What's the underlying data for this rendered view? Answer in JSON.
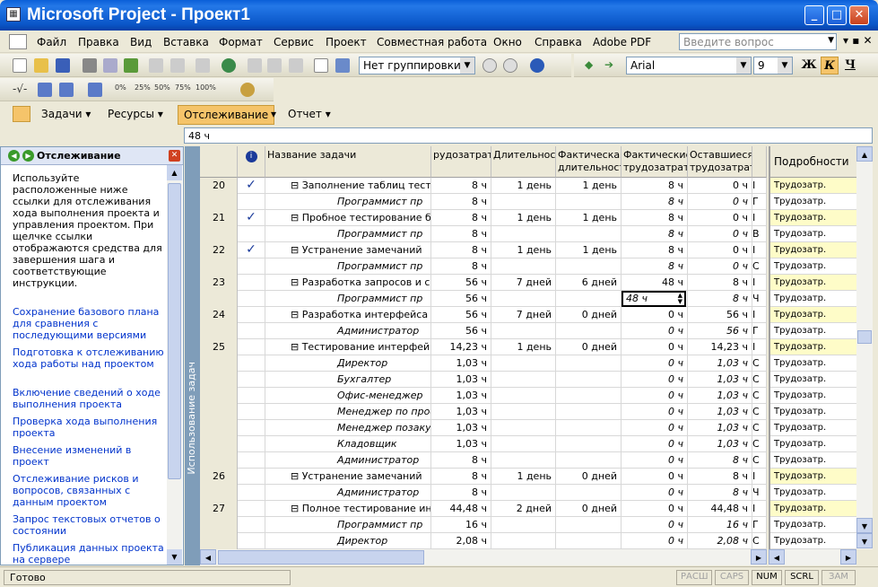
{
  "window": {
    "title": "Microsoft Project - Проект1",
    "minimize": "_",
    "restore": "□",
    "close": "✕"
  },
  "menu": {
    "items": [
      "Файл",
      "Правка",
      "Вид",
      "Вставка",
      "Формат",
      "Сервис",
      "Проект",
      "Совместная работа",
      "Окно",
      "Справка",
      "Adobe PDF"
    ],
    "ask_placeholder": "Введите вопрос"
  },
  "toolbar": {
    "group_combo": "Нет группировки",
    "font_combo": "Arial",
    "size_combo": "9",
    "bold": "Ж",
    "italic": "К",
    "underline": "Ч",
    "percent_buttons": [
      "0%",
      "25%",
      "50%",
      "75%",
      "100%"
    ]
  },
  "guide": {
    "tasks": "Задачи",
    "resources": "Ресурсы",
    "tracking": "Отслеживание",
    "report": "Отчет"
  },
  "entry": {
    "value": "48 ч"
  },
  "sidepane": {
    "title": "Отслеживание",
    "intro": "Используйте расположенные ниже ссылки для отслеживания хода выполнения проекта и управления проектом. При щелчке ссылки отображаются средства для завершения шага и соответствующие инструкции.",
    "links": [
      "Сохранение базового плана для сравнения с последующими версиями",
      "Подготовка к отслеживанию хода работы над проектом",
      "Включение сведений о ходе выполнения проекта",
      "Проверка хода выполнения проекта",
      "Внесение изменений в проект",
      "Отслеживание рисков и вопросов, связанных с данным проектом",
      "Запрос текстовых отчетов о состоянии",
      "Публикация данных проекта на сервере"
    ]
  },
  "view_label": "Использование задач",
  "grid": {
    "headers": {
      "info": "i",
      "name": "Название задачи",
      "work": "рудозатрат",
      "duration": "Длительност",
      "actual_duration": "Фактическая длительност",
      "actual_work": "Фактические трудозатрать",
      "remaining_work": "Оставшиеся трудозатрать"
    },
    "rows": [
      {
        "num": "20",
        "check": "✓",
        "name": "⊟ Заполнение таблиц тест",
        "work": "8 ч",
        "dur": "1 день",
        "adur": "1 день",
        "awork": "8 ч",
        "rwork": "0 ч",
        "x": "I",
        "sub": false
      },
      {
        "num": "",
        "check": "",
        "name": "Программист пр",
        "work": "8 ч",
        "dur": "",
        "adur": "",
        "awork": "8 ч",
        "rwork": "0 ч",
        "x": "Г",
        "sub": true
      },
      {
        "num": "21",
        "check": "✓",
        "name": "⊟ Пробное тестирование б",
        "work": "8 ч",
        "dur": "1 день",
        "adur": "1 день",
        "awork": "8 ч",
        "rwork": "0 ч",
        "x": "I",
        "sub": false
      },
      {
        "num": "",
        "check": "",
        "name": "Программист пр",
        "work": "8 ч",
        "dur": "",
        "adur": "",
        "awork": "8 ч",
        "rwork": "0 ч",
        "x": "В",
        "sub": true
      },
      {
        "num": "22",
        "check": "✓",
        "name": "⊟ Устранение замечаний",
        "work": "8 ч",
        "dur": "1 день",
        "adur": "1 день",
        "awork": "8 ч",
        "rwork": "0 ч",
        "x": "I",
        "sub": false
      },
      {
        "num": "",
        "check": "",
        "name": "Программист пр",
        "work": "8 ч",
        "dur": "",
        "adur": "",
        "awork": "8 ч",
        "rwork": "0 ч",
        "x": "С",
        "sub": true
      },
      {
        "num": "23",
        "check": "",
        "name": "⊟ Разработка запросов и с",
        "work": "56 ч",
        "dur": "7 дней",
        "adur": "6 дней",
        "awork": "48 ч",
        "rwork": "8 ч",
        "x": "I",
        "sub": false
      },
      {
        "num": "",
        "check": "",
        "name": "Программист пр",
        "work": "56 ч",
        "dur": "",
        "adur": "",
        "awork": "48 ч",
        "rwork": "8 ч",
        "x": "Ч",
        "sub": true
      },
      {
        "num": "24",
        "check": "",
        "name": "⊟ Разработка интерфейса",
        "work": "56 ч",
        "dur": "7 дней",
        "adur": "0 дней",
        "awork": "0 ч",
        "rwork": "56 ч",
        "x": "I",
        "sub": false
      },
      {
        "num": "",
        "check": "",
        "name": "Администратор",
        "work": "56 ч",
        "dur": "",
        "adur": "",
        "awork": "0 ч",
        "rwork": "56 ч",
        "x": "Г",
        "sub": true
      },
      {
        "num": "25",
        "check": "",
        "name": "⊟ Тестирование интерфей",
        "work": "14,23 ч",
        "dur": "1 день",
        "adur": "0 дней",
        "awork": "0 ч",
        "rwork": "14,23 ч",
        "x": "I",
        "sub": false
      },
      {
        "num": "",
        "check": "",
        "name": "Директор",
        "work": "1,03 ч",
        "dur": "",
        "adur": "",
        "awork": "0 ч",
        "rwork": "1,03 ч",
        "x": "С",
        "sub": true
      },
      {
        "num": "",
        "check": "",
        "name": "Бухгалтер",
        "work": "1,03 ч",
        "dur": "",
        "adur": "",
        "awork": "0 ч",
        "rwork": "1,03 ч",
        "x": "С",
        "sub": true
      },
      {
        "num": "",
        "check": "",
        "name": "Офис-менеджер",
        "work": "1,03 ч",
        "dur": "",
        "adur": "",
        "awork": "0 ч",
        "rwork": "1,03 ч",
        "x": "С",
        "sub": true
      },
      {
        "num": "",
        "check": "",
        "name": "Менеджер по прое",
        "work": "1,03 ч",
        "dur": "",
        "adur": "",
        "awork": "0 ч",
        "rwork": "1,03 ч",
        "x": "С",
        "sub": true
      },
      {
        "num": "",
        "check": "",
        "name": "Менеджер позаку",
        "work": "1,03 ч",
        "dur": "",
        "adur": "",
        "awork": "0 ч",
        "rwork": "1,03 ч",
        "x": "С",
        "sub": true
      },
      {
        "num": "",
        "check": "",
        "name": "Кладовщик",
        "work": "1,03 ч",
        "dur": "",
        "adur": "",
        "awork": "0 ч",
        "rwork": "1,03 ч",
        "x": "С",
        "sub": true
      },
      {
        "num": "",
        "check": "",
        "name": "Администратор",
        "work": "8 ч",
        "dur": "",
        "adur": "",
        "awork": "0 ч",
        "rwork": "8 ч",
        "x": "С",
        "sub": true
      },
      {
        "num": "26",
        "check": "",
        "name": "⊟ Устранение замечаний",
        "work": "8 ч",
        "dur": "1 день",
        "adur": "0 дней",
        "awork": "0 ч",
        "rwork": "8 ч",
        "x": "I",
        "sub": false
      },
      {
        "num": "",
        "check": "",
        "name": "Администратор",
        "work": "8 ч",
        "dur": "",
        "adur": "",
        "awork": "0 ч",
        "rwork": "8 ч",
        "x": "Ч",
        "sub": true
      },
      {
        "num": "27",
        "check": "",
        "name": "⊟ Полное тестирование ин",
        "work": "44,48 ч",
        "dur": "2 дней",
        "adur": "0 дней",
        "awork": "0 ч",
        "rwork": "44,48 ч",
        "x": "I",
        "sub": false
      },
      {
        "num": "",
        "check": "",
        "name": "Программист пр",
        "work": "16 ч",
        "dur": "",
        "adur": "",
        "awork": "0 ч",
        "rwork": "16 ч",
        "x": "Г",
        "sub": true
      },
      {
        "num": "",
        "check": "",
        "name": "Директор",
        "work": "2,08 ч",
        "dur": "",
        "adur": "",
        "awork": "0 ч",
        "rwork": "2,08 ч",
        "x": "С",
        "sub": true
      }
    ],
    "edit_value": "48 ч"
  },
  "details": {
    "header": "Подробности",
    "row_label": "Трудозатр."
  },
  "status": {
    "ready": "Готово",
    "indicators": [
      "РАСШ",
      "CAPS",
      "NUM",
      "SCRL",
      "ЗАМ"
    ]
  }
}
